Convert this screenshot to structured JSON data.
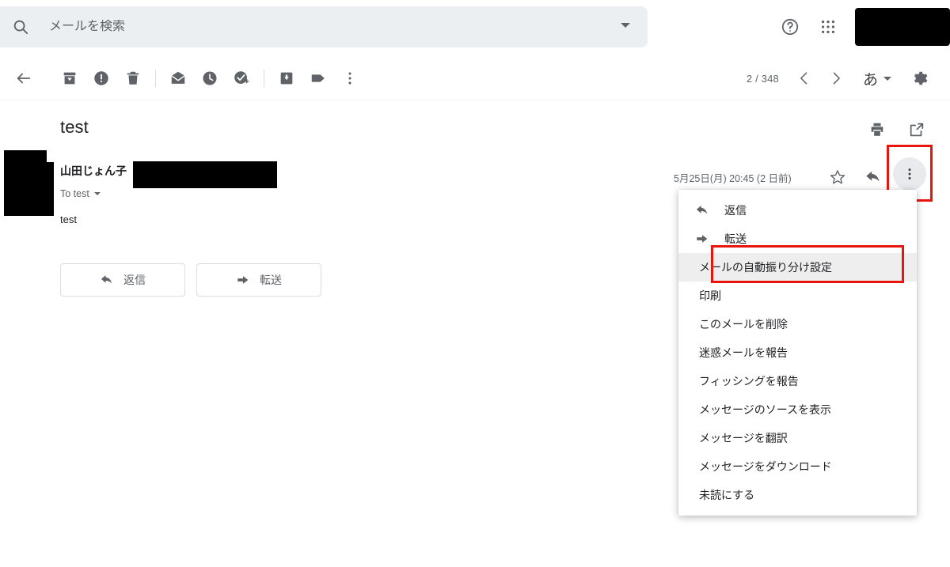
{
  "search": {
    "placeholder": "メールを検索",
    "value": "",
    "icon": "search-icon",
    "dropdown_icon": "chevron-down-icon"
  },
  "header": {
    "help_icon": "help-icon",
    "apps_icon": "apps-grid-icon",
    "account_label": ""
  },
  "toolbar": {
    "back_icon": "back-arrow-icon",
    "archive_icon": "archive-icon",
    "spam_icon": "report-spam-icon",
    "delete_icon": "trash-icon",
    "mark_unread_icon": "mark-unread-icon",
    "snooze_icon": "clock-snooze-icon",
    "add_task_icon": "add-to-tasks-icon",
    "move_icon": "move-to-inbox-icon",
    "label_icon": "label-icon",
    "more_icon": "more-vertical-icon",
    "page_count": "2 / 348",
    "prev_icon": "chevron-left-icon",
    "next_icon": "chevron-right-icon",
    "ime_label": "あ",
    "settings_icon": "gear-icon"
  },
  "message": {
    "subject": "test",
    "print_icon": "print-icon",
    "popout_icon": "open-in-new-icon",
    "sender_name": "山田じょん子",
    "to_line": "To test",
    "body": "test",
    "date": "5月25日(月) 20:45 (2 日前)",
    "star_icon": "star-outline-icon",
    "reply_icon": "reply-arrow-icon",
    "more_icon": "more-vertical-icon"
  },
  "actions": {
    "reply_label": "返信",
    "reply_icon": "reply-arrow-icon",
    "forward_label": "転送",
    "forward_icon": "forward-arrow-icon"
  },
  "menu": {
    "items": [
      {
        "label": "返信",
        "icon": "reply-arrow-icon",
        "highlighted": false
      },
      {
        "label": "転送",
        "icon": "forward-arrow-icon",
        "highlighted": false
      },
      {
        "label": "メールの自動振り分け設定",
        "icon": "",
        "highlighted": true
      },
      {
        "label": "印刷",
        "icon": "",
        "highlighted": false
      },
      {
        "label": "このメールを削除",
        "icon": "",
        "highlighted": false
      },
      {
        "label": "迷惑メールを報告",
        "icon": "",
        "highlighted": false
      },
      {
        "label": "フィッシングを報告",
        "icon": "",
        "highlighted": false
      },
      {
        "label": "メッセージのソースを表示",
        "icon": "",
        "highlighted": false
      },
      {
        "label": "メッセージを翻訳",
        "icon": "",
        "highlighted": false
      },
      {
        "label": "メッセージをダウンロード",
        "icon": "",
        "highlighted": false
      },
      {
        "label": "未読にする",
        "icon": "",
        "highlighted": false
      }
    ]
  },
  "annotations": {
    "highlight_color": "#e8150f",
    "redaction_color": "#000000"
  }
}
